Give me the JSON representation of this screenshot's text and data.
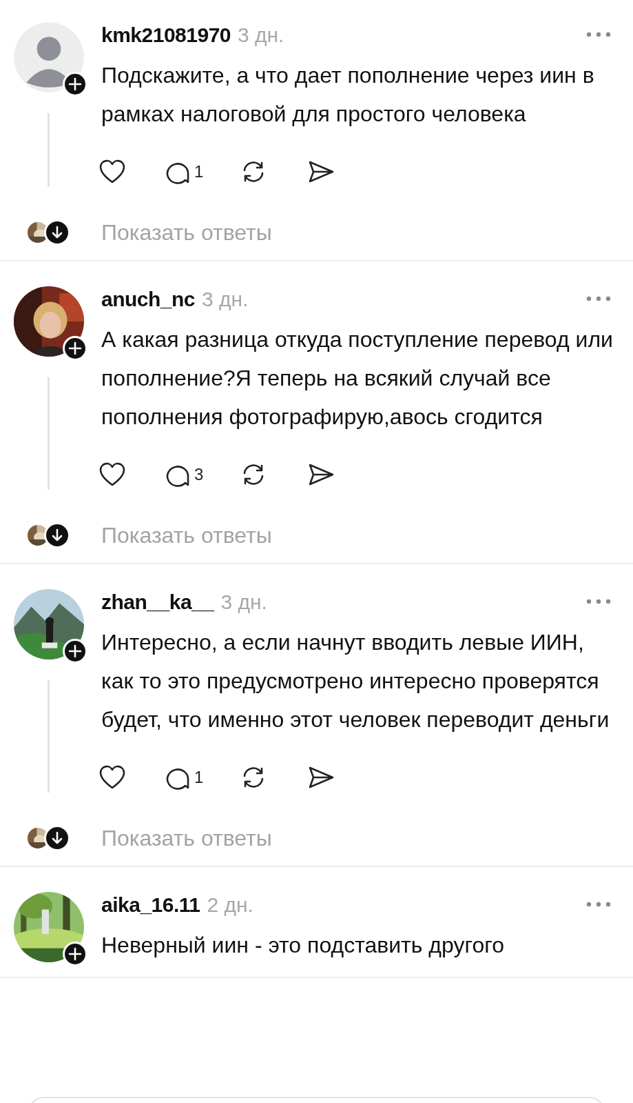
{
  "comments": [
    {
      "author": "kmk21081970",
      "time": "3 дн.",
      "avatar": {
        "kind": "silhouette"
      },
      "text": "Подскажите, а что дает пополнение через иин в рамках налоговой для простого человека",
      "comments_count": "1",
      "show_replies": "Показать ответы"
    },
    {
      "author": "anuch_nc",
      "time": "3 дн.",
      "text": "А какая разница откуда поступление перевод или пополнение?Я теперь на всякий случай все пополнения фотографирую,авось сгодится",
      "comments_count": "3",
      "show_replies": "Показать ответы"
    },
    {
      "author": "zhan__ka__",
      "time": "3 дн.",
      "text": "Интересно, а если начнут вводить левые ИИН, как то это предусмотрено интересно проверятся будет, что именно этот человек переводит деньги",
      "comments_count": "1",
      "show_replies": "Показать ответы"
    },
    {
      "author": "aika_16.11",
      "time": "2 дн.",
      "text": "Неверный иин - это подставить другого"
    }
  ]
}
